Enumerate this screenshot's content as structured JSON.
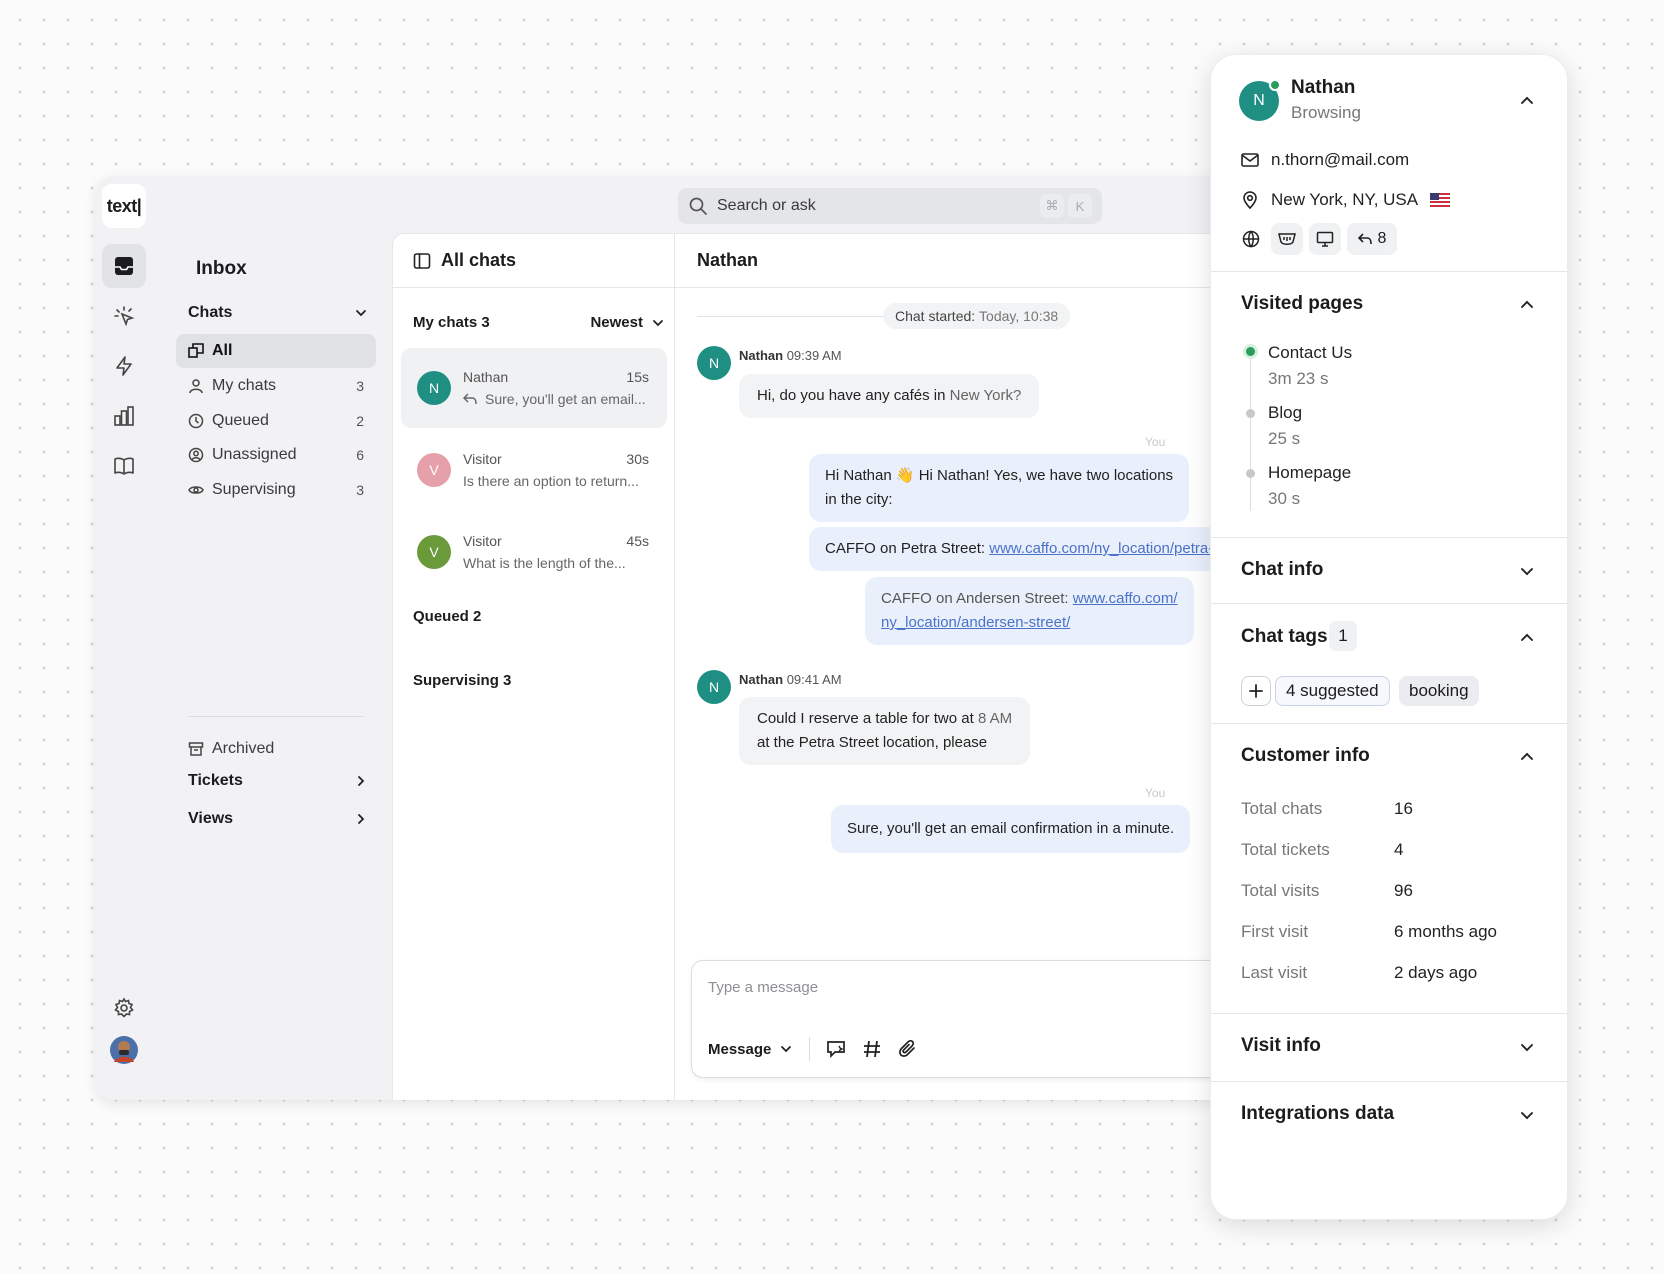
{
  "app": {
    "logo": "text|"
  },
  "search": {
    "placeholder": "Search or ask",
    "shortcut_cmd": "⌘",
    "shortcut_key": "K"
  },
  "nav": {
    "title": "Inbox",
    "chats_section": "Chats",
    "items": [
      {
        "label": "All",
        "count": ""
      },
      {
        "label": "My chats",
        "count": "3"
      },
      {
        "label": "Queued",
        "count": "2"
      },
      {
        "label": "Unassigned",
        "count": "6"
      },
      {
        "label": "Supervising",
        "count": "3"
      }
    ],
    "archived": "Archived",
    "tickets": "Tickets",
    "views": "Views"
  },
  "list": {
    "header": "All chats",
    "group_my": "My chats 3",
    "sort": "Newest",
    "chats": [
      {
        "initial": "N",
        "name": "Nathan",
        "time": "15s",
        "preview": "Sure, you'll get an email...",
        "color": "#1f8f84"
      },
      {
        "initial": "V",
        "name": "Visitor",
        "time": "30s",
        "preview": "Is there an option to return...",
        "color": "#e6a0aa"
      },
      {
        "initial": "V",
        "name": "Visitor",
        "time": "45s",
        "preview": "What is the length of the...",
        "color": "#6a9a3a"
      }
    ],
    "group_queued": "Queued 2",
    "group_supervising": "Supervising 3"
  },
  "conversation": {
    "title": "Nathan",
    "started_label": "Chat started:",
    "started_value": "Today, 10:38",
    "you_label": "You",
    "messages": {
      "m1_name": "Nathan",
      "m1_time": "09:39 AM",
      "m1_text_a": "Hi, do you have any cafés in ",
      "m1_text_b": "New York?",
      "r1_text_a": "Hi Nathan 👋 Hi Nathan! Yes, we have two locations",
      "r1_text_b": "in the city:",
      "r2_label": "CAFFO on Petra Street: ",
      "r2_link": "www.caffo.com/ny_location/petra-street/",
      "r3_label": "CAFFO on Andersen Street: ",
      "r3_link_a": "www.caffo.com/",
      "r3_link_b": "ny_location/andersen-street/",
      "m2_name": "Nathan",
      "m2_time": "09:41 AM",
      "m2_text_a": "Could I reserve a table for two at ",
      "m2_text_b": "8 AM",
      "m2_text_c": "at the Petra Street location, please",
      "r4_text": "Sure, you'll get an email confirmation in a minute."
    },
    "composer": {
      "placeholder": "Type a message",
      "mode": "Message"
    }
  },
  "customer": {
    "initial": "N",
    "name": "Nathan",
    "status": "Browsing",
    "email": "n.thorn@mail.com",
    "location": "New York, NY, USA",
    "returns": "8",
    "avatar_color": "#1f8f84",
    "online_color": "#2a9d5a"
  },
  "visited": {
    "title": "Visited pages",
    "pages": [
      {
        "name": "Contact Us",
        "time": "3m 23 s"
      },
      {
        "name": "Blog",
        "time": "25 s"
      },
      {
        "name": "Homepage",
        "time": "30 s"
      }
    ]
  },
  "chat_info": {
    "title": "Chat info"
  },
  "chat_tags": {
    "title": "Chat tags",
    "count": "1",
    "suggested": "4 suggested",
    "tag": "booking"
  },
  "customer_info": {
    "title": "Customer info",
    "rows": [
      {
        "label": "Total chats",
        "value": "16"
      },
      {
        "label": "Total tickets",
        "value": "4"
      },
      {
        "label": "Total visits",
        "value": "96"
      },
      {
        "label": "First visit",
        "value": "6 months ago"
      },
      {
        "label": "Last visit",
        "value": "2 days ago"
      }
    ]
  },
  "visit_info": {
    "title": "Visit info"
  },
  "integrations": {
    "title": "Integrations data"
  }
}
